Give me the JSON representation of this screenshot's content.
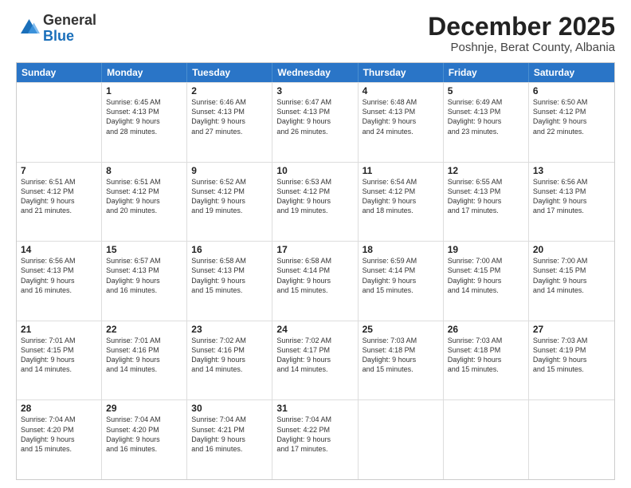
{
  "logo": {
    "general": "General",
    "blue": "Blue"
  },
  "header": {
    "month": "December 2025",
    "location": "Poshnje, Berat County, Albania"
  },
  "days": [
    "Sunday",
    "Monday",
    "Tuesday",
    "Wednesday",
    "Thursday",
    "Friday",
    "Saturday"
  ],
  "rows": [
    [
      {
        "day": "",
        "info": ""
      },
      {
        "day": "1",
        "info": "Sunrise: 6:45 AM\nSunset: 4:13 PM\nDaylight: 9 hours\nand 28 minutes."
      },
      {
        "day": "2",
        "info": "Sunrise: 6:46 AM\nSunset: 4:13 PM\nDaylight: 9 hours\nand 27 minutes."
      },
      {
        "day": "3",
        "info": "Sunrise: 6:47 AM\nSunset: 4:13 PM\nDaylight: 9 hours\nand 26 minutes."
      },
      {
        "day": "4",
        "info": "Sunrise: 6:48 AM\nSunset: 4:13 PM\nDaylight: 9 hours\nand 24 minutes."
      },
      {
        "day": "5",
        "info": "Sunrise: 6:49 AM\nSunset: 4:13 PM\nDaylight: 9 hours\nand 23 minutes."
      },
      {
        "day": "6",
        "info": "Sunrise: 6:50 AM\nSunset: 4:12 PM\nDaylight: 9 hours\nand 22 minutes."
      }
    ],
    [
      {
        "day": "7",
        "info": "Sunrise: 6:51 AM\nSunset: 4:12 PM\nDaylight: 9 hours\nand 21 minutes."
      },
      {
        "day": "8",
        "info": "Sunrise: 6:51 AM\nSunset: 4:12 PM\nDaylight: 9 hours\nand 20 minutes."
      },
      {
        "day": "9",
        "info": "Sunrise: 6:52 AM\nSunset: 4:12 PM\nDaylight: 9 hours\nand 19 minutes."
      },
      {
        "day": "10",
        "info": "Sunrise: 6:53 AM\nSunset: 4:12 PM\nDaylight: 9 hours\nand 19 minutes."
      },
      {
        "day": "11",
        "info": "Sunrise: 6:54 AM\nSunset: 4:12 PM\nDaylight: 9 hours\nand 18 minutes."
      },
      {
        "day": "12",
        "info": "Sunrise: 6:55 AM\nSunset: 4:13 PM\nDaylight: 9 hours\nand 17 minutes."
      },
      {
        "day": "13",
        "info": "Sunrise: 6:56 AM\nSunset: 4:13 PM\nDaylight: 9 hours\nand 17 minutes."
      }
    ],
    [
      {
        "day": "14",
        "info": "Sunrise: 6:56 AM\nSunset: 4:13 PM\nDaylight: 9 hours\nand 16 minutes."
      },
      {
        "day": "15",
        "info": "Sunrise: 6:57 AM\nSunset: 4:13 PM\nDaylight: 9 hours\nand 16 minutes."
      },
      {
        "day": "16",
        "info": "Sunrise: 6:58 AM\nSunset: 4:13 PM\nDaylight: 9 hours\nand 15 minutes."
      },
      {
        "day": "17",
        "info": "Sunrise: 6:58 AM\nSunset: 4:14 PM\nDaylight: 9 hours\nand 15 minutes."
      },
      {
        "day": "18",
        "info": "Sunrise: 6:59 AM\nSunset: 4:14 PM\nDaylight: 9 hours\nand 15 minutes."
      },
      {
        "day": "19",
        "info": "Sunrise: 7:00 AM\nSunset: 4:15 PM\nDaylight: 9 hours\nand 14 minutes."
      },
      {
        "day": "20",
        "info": "Sunrise: 7:00 AM\nSunset: 4:15 PM\nDaylight: 9 hours\nand 14 minutes."
      }
    ],
    [
      {
        "day": "21",
        "info": "Sunrise: 7:01 AM\nSunset: 4:15 PM\nDaylight: 9 hours\nand 14 minutes."
      },
      {
        "day": "22",
        "info": "Sunrise: 7:01 AM\nSunset: 4:16 PM\nDaylight: 9 hours\nand 14 minutes."
      },
      {
        "day": "23",
        "info": "Sunrise: 7:02 AM\nSunset: 4:16 PM\nDaylight: 9 hours\nand 14 minutes."
      },
      {
        "day": "24",
        "info": "Sunrise: 7:02 AM\nSunset: 4:17 PM\nDaylight: 9 hours\nand 14 minutes."
      },
      {
        "day": "25",
        "info": "Sunrise: 7:03 AM\nSunset: 4:18 PM\nDaylight: 9 hours\nand 15 minutes."
      },
      {
        "day": "26",
        "info": "Sunrise: 7:03 AM\nSunset: 4:18 PM\nDaylight: 9 hours\nand 15 minutes."
      },
      {
        "day": "27",
        "info": "Sunrise: 7:03 AM\nSunset: 4:19 PM\nDaylight: 9 hours\nand 15 minutes."
      }
    ],
    [
      {
        "day": "28",
        "info": "Sunrise: 7:04 AM\nSunset: 4:20 PM\nDaylight: 9 hours\nand 15 minutes."
      },
      {
        "day": "29",
        "info": "Sunrise: 7:04 AM\nSunset: 4:20 PM\nDaylight: 9 hours\nand 16 minutes."
      },
      {
        "day": "30",
        "info": "Sunrise: 7:04 AM\nSunset: 4:21 PM\nDaylight: 9 hours\nand 16 minutes."
      },
      {
        "day": "31",
        "info": "Sunrise: 7:04 AM\nSunset: 4:22 PM\nDaylight: 9 hours\nand 17 minutes."
      },
      {
        "day": "",
        "info": ""
      },
      {
        "day": "",
        "info": ""
      },
      {
        "day": "",
        "info": ""
      }
    ]
  ]
}
